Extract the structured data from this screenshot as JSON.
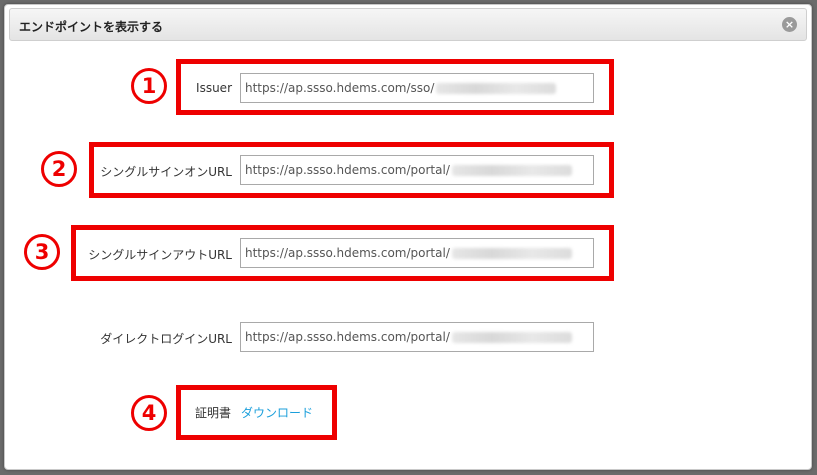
{
  "dialog": {
    "title": "エンドポイントを表示する"
  },
  "fields": [
    {
      "label": "Issuer",
      "value": "https://ap.ssso.hdems.com/sso/"
    },
    {
      "label": "シングルサインオンURL",
      "value": "https://ap.ssso.hdems.com/portal/"
    },
    {
      "label": "シングルサインアウトURL",
      "value": "https://ap.ssso.hdems.com/portal/"
    },
    {
      "label": "ダイレクトログインURL",
      "value": "https://ap.ssso.hdems.com/portal/"
    }
  ],
  "certificate": {
    "label": "証明書",
    "link": "ダウンロード"
  },
  "markers": [
    "1",
    "2",
    "3",
    "4"
  ],
  "colors": {
    "highlight": "#ee0000",
    "link": "#1b9fdb"
  }
}
